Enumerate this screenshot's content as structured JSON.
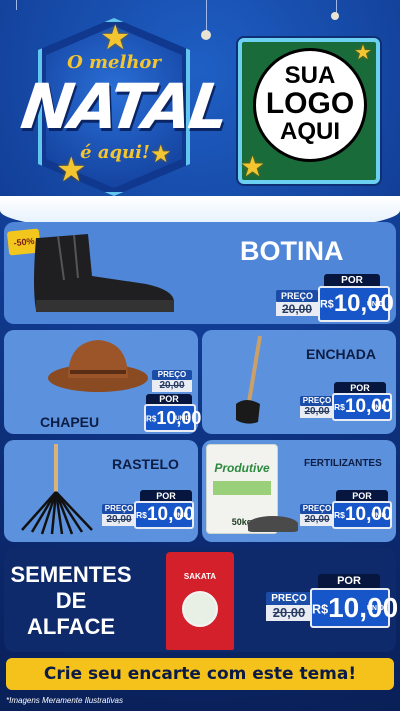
{
  "header": {
    "o_melhor": "O melhor",
    "natal": "NATAL",
    "e_aqui": "é aqui!",
    "logo_lines": [
      "SUA",
      "LOGO",
      "AQUI"
    ]
  },
  "products": {
    "botina": {
      "name": "BOTINA",
      "discount": "-50%",
      "preco": "PREÇO",
      "old_price": "20,00",
      "por": "POR",
      "currency": "R$",
      "new_price": "10,00",
      "unit": "UNID"
    },
    "chapeu": {
      "name": "CHAPEU",
      "preco": "PREÇO",
      "old_price": "20,00",
      "por": "POR",
      "currency": "R$",
      "new_price": "10,00",
      "unit": "UNID"
    },
    "enchada": {
      "name": "ENCHADA",
      "preco": "PREÇO",
      "old_price": "20,00",
      "por": "POR",
      "currency": "R$",
      "new_price": "10,00",
      "unit": "UNID"
    },
    "rastelo": {
      "name": "RASTELO",
      "preco": "PREÇO",
      "old_price": "20,00",
      "por": "POR",
      "currency": "R$",
      "new_price": "10,00",
      "unit": "UNID"
    },
    "fertilizantes": {
      "name": "FERTILIZANTES",
      "bag_brand": "Produtive",
      "bag_weight": "50kg",
      "preco": "PREÇO",
      "old_price": "20,00",
      "por": "POR",
      "currency": "R$",
      "new_price": "10,00",
      "unit": "UNID"
    },
    "sementes": {
      "name_lines": [
        "SEMENTES",
        "DE",
        "ALFACE"
      ],
      "pack_brand": "SAKATA",
      "preco": "PREÇO",
      "old_price": "20,00",
      "por": "POR",
      "currency": "R$",
      "new_price": "10,00",
      "unit": "UNID"
    }
  },
  "footer": {
    "cta": "Crie seu encarte com este tema!",
    "disclaimer": "*Imagens Meramente Ilustrativas"
  },
  "colors": {
    "navy": "#0b2a6e",
    "card_blue": "#4f86d8",
    "gold": "#f4c21b",
    "price_blue": "#1656c8"
  }
}
